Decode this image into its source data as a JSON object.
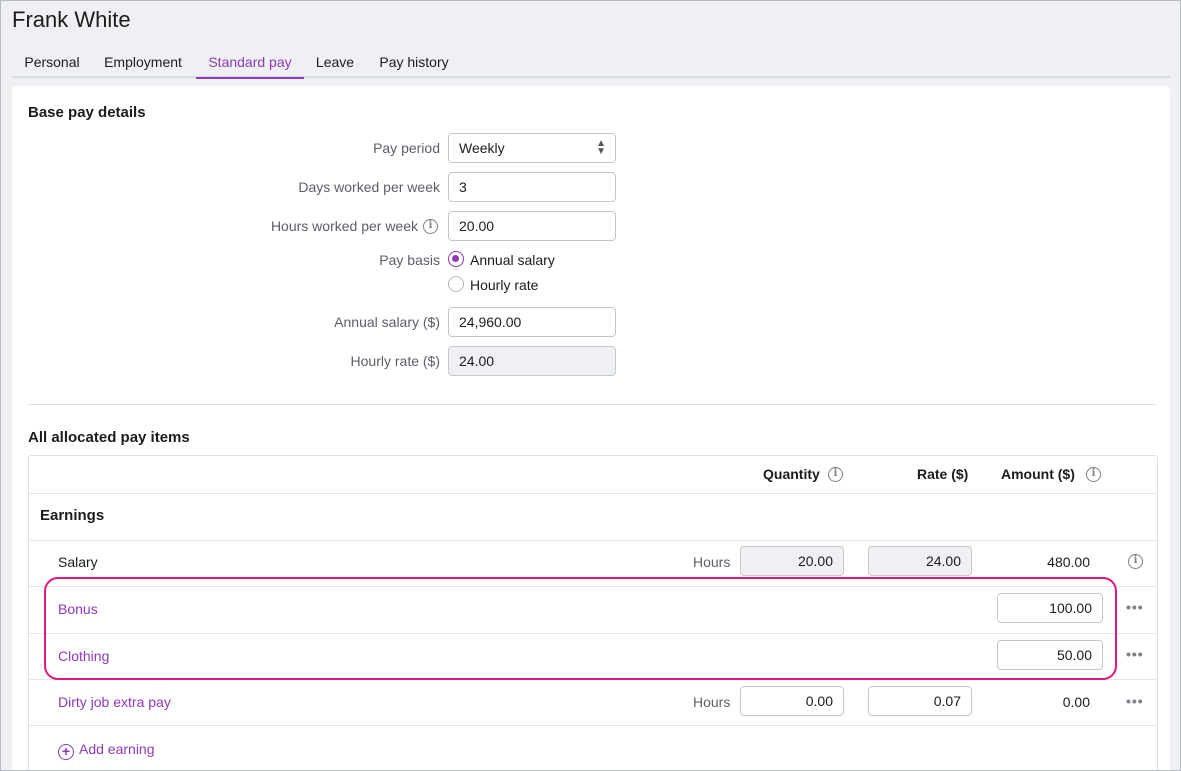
{
  "header": {
    "title": "Frank White"
  },
  "tabs": [
    {
      "label": "Personal"
    },
    {
      "label": "Employment"
    },
    {
      "label": "Standard pay",
      "active": true
    },
    {
      "label": "Leave"
    },
    {
      "label": "Pay history"
    }
  ],
  "base_pay": {
    "title": "Base pay details",
    "pay_period_label": "Pay period",
    "pay_period_value": "Weekly",
    "days_label": "Days worked per week",
    "days_value": "3",
    "hours_label": "Hours worked per week",
    "hours_value": "20.00",
    "pay_basis_label": "Pay basis",
    "pay_basis_options": [
      "Annual salary",
      "Hourly rate"
    ],
    "pay_basis_selected": "Annual salary",
    "annual_label": "Annual salary ($)",
    "annual_value": "24,960.00",
    "hourly_label": "Hourly rate ($)",
    "hourly_value": "24.00"
  },
  "pay_items": {
    "title": "All allocated pay items",
    "columns": {
      "quantity": "Quantity",
      "rate": "Rate ($)",
      "amount": "Amount ($)"
    },
    "earnings_heading": "Earnings",
    "rows": [
      {
        "name": "Salary",
        "unit": "Hours",
        "quantity": "20.00",
        "rate": "24.00",
        "amount": "480.00"
      },
      {
        "name": "Bonus",
        "amount_input": "100.00"
      },
      {
        "name": "Clothing",
        "amount_input": "50.00"
      },
      {
        "name": "Dirty job extra pay",
        "unit": "Hours",
        "quantity": "0.00",
        "rate": "0.07",
        "amount": "0.00"
      }
    ],
    "add_earning": "Add earning"
  },
  "colors": {
    "accent": "#8e39b8",
    "highlight": "#e0177c"
  }
}
